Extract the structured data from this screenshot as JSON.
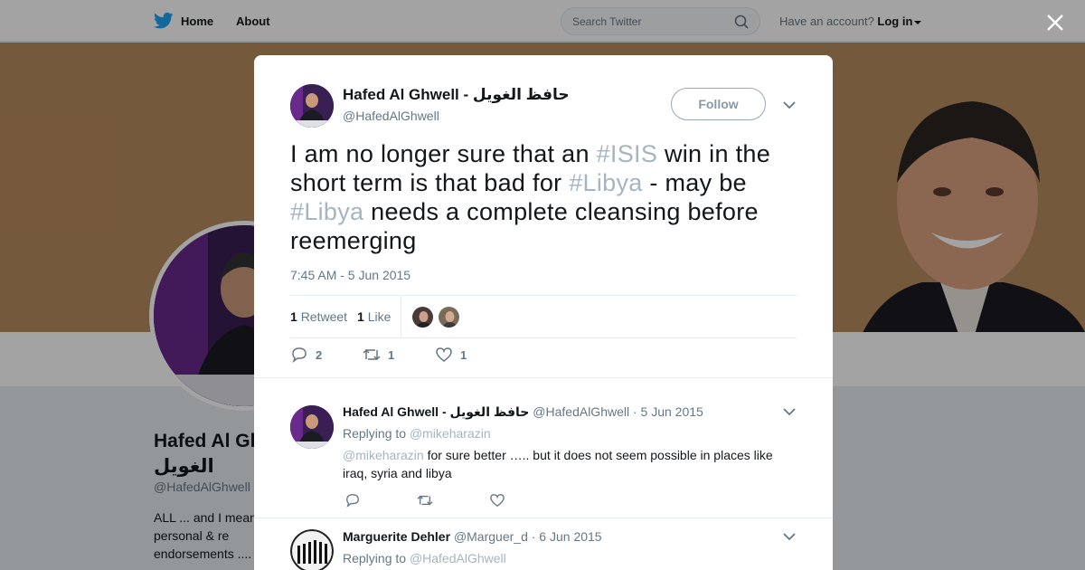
{
  "nav": {
    "home_label": "Home",
    "about_label": "About",
    "search_placeholder": "Search Twitter",
    "account_prompt": "Have an account?",
    "login_label": "Log in"
  },
  "profile": {
    "name_line1": "Hafed Al Gh",
    "name_line2": "الغويل",
    "handle": "@HafedAlGhwell",
    "bio": "ALL ... and I mean are personal & re endorsements ...."
  },
  "tweet": {
    "author_name": "Hafed Al Ghwell - حافظ الغويل",
    "author_handle": "@HafedAlGhwell",
    "follow_label": "Follow",
    "text_parts": {
      "p1": "I am no longer sure that an ",
      "tag1": "#ISIS",
      "p2": " win in the short term is that bad for ",
      "tag2": "#Libya",
      "p3": " - may be ",
      "tag3": "#Libya",
      "p4": " needs a complete cleansing before reemerging"
    },
    "timestamp": "7:45 AM - 5 Jun 2015",
    "retweet_count": "1",
    "retweet_label": "Retweet",
    "like_count": "1",
    "like_label": "Like",
    "action_counts": {
      "reply": "2",
      "retweet": "1",
      "like": "1"
    }
  },
  "replies": [
    {
      "name": "Hafed Al Ghwell - حافظ الغويل",
      "handle": "@HafedAlGhwell",
      "date": "· 5 Jun 2015",
      "replying_label": "Replying to",
      "replying_to": "@mikeharazin",
      "mention": "@mikeharazin",
      "text": " for sure better ….. but it does not seem possible in places like iraq, syria and libya"
    },
    {
      "name": "Marguerite Dehler",
      "handle": "@Marguer_d",
      "date": "· 6 Jun 2015",
      "replying_label": "Replying to",
      "replying_to": "@HafedAlGhwell"
    }
  ],
  "colors": {
    "link_muted": "#a5b5c2",
    "text_secondary": "#657786",
    "twitter_blue": "#1da1f2",
    "banner": "#b88c5f"
  },
  "icons": [
    "twitter-bird-icon",
    "search-icon",
    "close-icon",
    "chevron-down-icon",
    "reply-icon",
    "retweet-icon",
    "like-icon"
  ]
}
